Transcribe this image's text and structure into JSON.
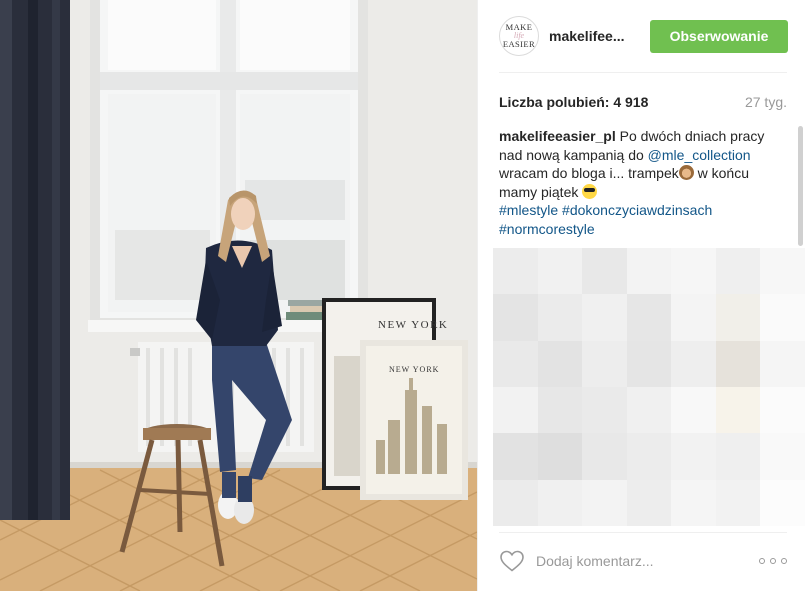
{
  "post": {
    "image_alt": "Photo: woman on a stool by the window next to framed New York posters",
    "poster_text": "NEW YORK"
  },
  "author": {
    "avatar_logo": [
      "MAKE",
      "life",
      "EASIER"
    ],
    "username": "makelifee...",
    "follow_label": "Obserwowanie"
  },
  "stats": {
    "likes": "Liczba polubień: 4 918",
    "age": "27 tyg."
  },
  "caption": {
    "username": "makelifeeasier_pl",
    "text_1": "Po dwóch dniach pracy nad nową kampanią do",
    "mention": "@mle_collection",
    "text_2": "wracam do bloga i... trampek",
    "text_3": "w końcu mamy piątek",
    "hashtags": [
      "#mlestyle",
      "#dokonczyciawdzinsach",
      "#normcorestyle"
    ]
  },
  "comment": {
    "placeholder": "Dodaj komentarz..."
  },
  "icons": {
    "like": "heart-icon",
    "more": "ellipsis-icon",
    "emoji_1": "monkey-emoji-icon",
    "emoji_2": "sunglasses-emoji-icon"
  },
  "colors": {
    "follow_button": "#70c050",
    "link": "#125688",
    "muted": "#999999"
  }
}
